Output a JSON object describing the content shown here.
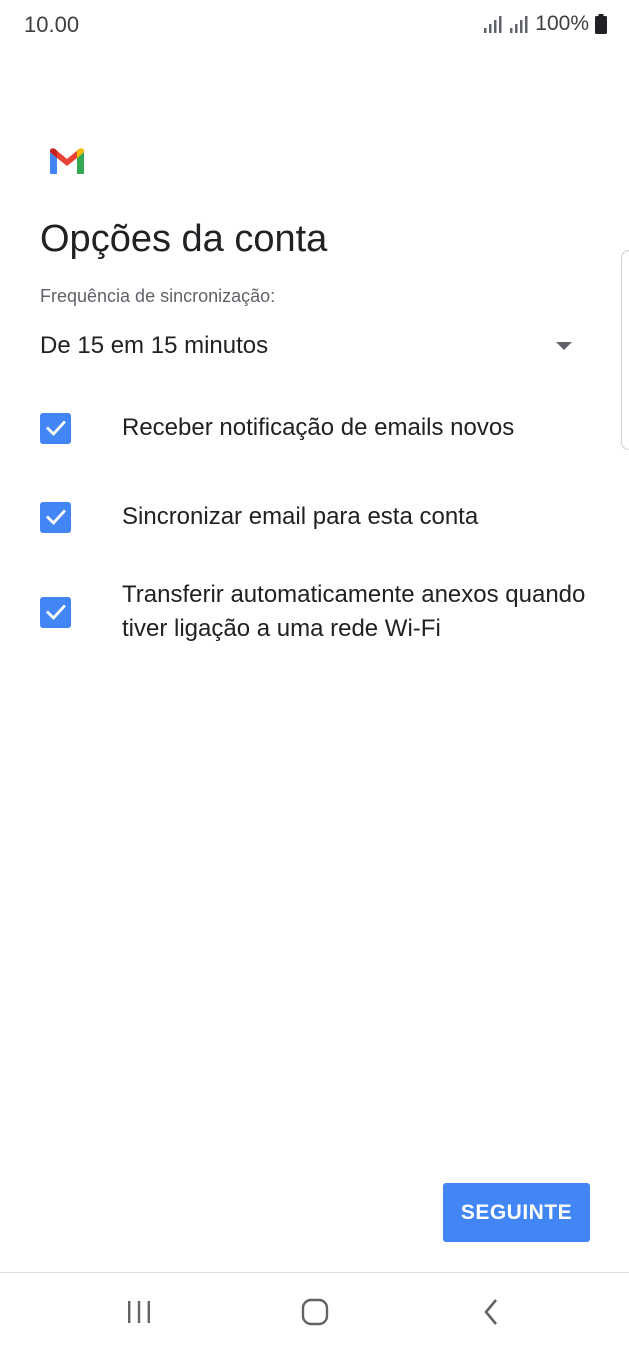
{
  "status_bar": {
    "time": "10.00",
    "battery_percent": "100%",
    "icons": [
      "signal-icon",
      "signal-icon",
      "battery-icon"
    ]
  },
  "app": {
    "logo_icon": "gmail-logo-icon",
    "title": "Opções da conta"
  },
  "sync": {
    "label": "Frequência de sincronização:",
    "selected_value": "De 15 em 15 minutos"
  },
  "options": [
    {
      "label": "Receber notificação de emails novos",
      "checked": true
    },
    {
      "label": "Sincronizar email para esta conta",
      "checked": true
    },
    {
      "label": "Transferir automaticamente anexos quando tiver ligação a uma rede Wi-Fi",
      "checked": true
    }
  ],
  "next_button": {
    "label": "SEGUINTE"
  },
  "nav_bar": {
    "icons": [
      "recent-apps-icon",
      "home-icon",
      "back-icon"
    ]
  },
  "colors": {
    "accent": "#4285f4",
    "text_primary": "#202124",
    "text_secondary": "#5f6368"
  }
}
